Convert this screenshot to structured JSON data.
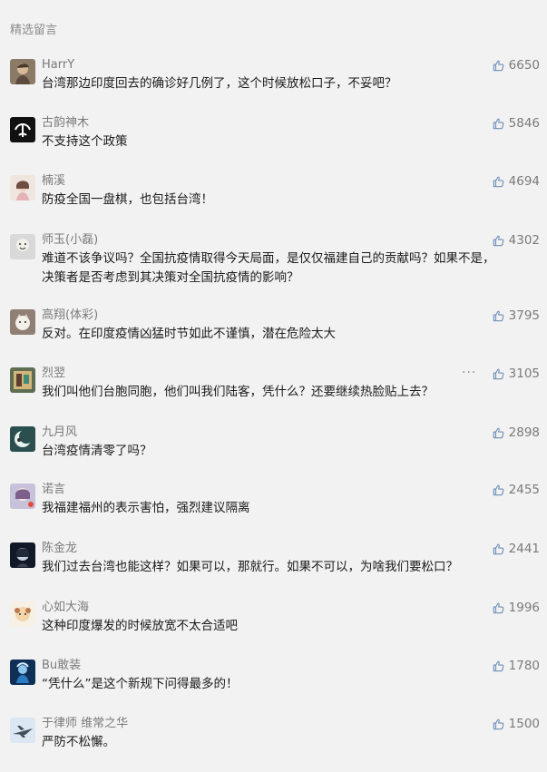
{
  "section_title": "精选留言",
  "comments": [
    {
      "nick": "HarrY",
      "likes": "6650",
      "lines": [
        "台湾那边印度回去的确诊好几例了，这个时候放松口子，不妥吧？"
      ],
      "avatar": "avatar-man-photo"
    },
    {
      "nick": "古韵神木",
      "likes": "5846",
      "lines": [
        "不支持这个政策"
      ],
      "avatar": "avatar-tree-icon"
    },
    {
      "nick": "楠溪",
      "likes": "4694",
      "lines": [
        "防疫全国一盘棋，也包括台湾！"
      ],
      "avatar": "avatar-girl-icon"
    },
    {
      "nick": "师玉(小磊)",
      "likes": "4302",
      "lines": [
        "难道不该争议吗？全国抗疫情取得今天局面，是仅仅福建自己的贡献吗？如果不是，",
        "决策者是否考虑到其决策对全国抗疫情的影响？"
      ],
      "avatar": "avatar-cartoon-icon"
    },
    {
      "nick": "高翔(体彩)",
      "likes": "3795",
      "lines": [
        "反对。在印度疫情凶猛时节如此不谨慎，潜在危险太大"
      ],
      "avatar": "avatar-cat-icon"
    },
    {
      "nick": "烈翌",
      "likes": "3105",
      "lines": [
        "我们叫他们台胞同胞，他们叫我们陆客，凭什么？还要继续热脸贴上去？"
      ],
      "avatar": "avatar-game-icon",
      "more": "···"
    },
    {
      "nick": "九月风",
      "likes": "2898",
      "lines": [
        "台湾疫情清零了吗？"
      ],
      "avatar": "avatar-moon-icon"
    },
    {
      "nick": "诺言",
      "likes": "2455",
      "lines": [
        "我福建福州的表示害怕，强烈建议隔离"
      ],
      "avatar": "avatar-anime-icon"
    },
    {
      "nick": "陈金龙",
      "likes": "2441",
      "lines": [
        "我们过去台湾也能这样？如果可以，那就行。如果不可以，为啥我们要松口？"
      ],
      "avatar": "avatar-dark-anime-icon"
    },
    {
      "nick": "心如大海",
      "likes": "1996",
      "lines": [
        "这种印度爆发的时候放宽不太合适吧"
      ],
      "avatar": "avatar-dog-icon"
    },
    {
      "nick": "Bu敢装",
      "likes": "1780",
      "lines": [
        "“凭什么”是这个新规下问得最多的！"
      ],
      "avatar": "avatar-blue-figure-icon"
    },
    {
      "nick": "于律师 维常之华",
      "likes": "1500",
      "lines": [
        "严防不松懈。"
      ],
      "avatar": "avatar-airplane-icon"
    }
  ],
  "colors": {
    "background": "#f2f2f2",
    "nickname": "#7a7a7a",
    "body_text": "#1a1a1a",
    "like_icon": "#6f8fb8"
  }
}
